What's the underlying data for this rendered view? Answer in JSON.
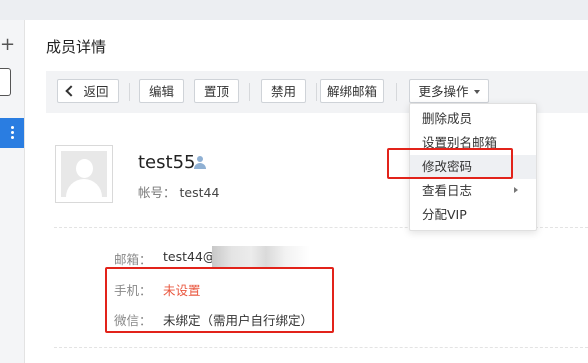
{
  "page": {
    "title": "成员详情"
  },
  "toolbar": {
    "back": "返回",
    "edit": "编辑",
    "pin": "置顶",
    "disable": "禁用",
    "unbind_email": "解绑邮箱",
    "more_actions": "更多操作"
  },
  "more_menu": {
    "items": [
      {
        "label": "删除成员"
      },
      {
        "label": "设置别名邮箱"
      },
      {
        "label": "修改密码"
      },
      {
        "label": "查看日志"
      },
      {
        "label": "分配VIP"
      }
    ]
  },
  "member": {
    "name": "test55",
    "account_label": "帐号：",
    "account": "test44"
  },
  "details": {
    "email_label": "邮箱：",
    "email": "test44@",
    "phone_label": "手机：",
    "phone": "未设置",
    "wechat_label": "微信：",
    "wechat": "未绑定（需用户自行绑定）"
  },
  "colors": {
    "accent": "#2a7de1",
    "warning_text": "#e9573f",
    "annotation_red": "#e2231a"
  },
  "icons": [
    "plus-icon",
    "kebab-icon",
    "chevron-left-icon",
    "caret-down-icon",
    "user-icon",
    "chevron-right-icon",
    "avatar-placeholder"
  ]
}
